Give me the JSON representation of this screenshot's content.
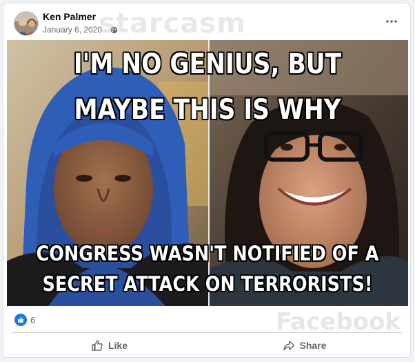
{
  "post": {
    "author": "Ken Palmer",
    "date": "January 6, 2020",
    "separator": "·",
    "privacy_icon": "globe-icon",
    "more_icon": "more-horizontal-icon"
  },
  "watermarks": {
    "top": "starcasm",
    "bottom": "Facebook"
  },
  "meme": {
    "top_line_1": "I'M NO GENIUS, BUT",
    "top_line_2": "MAYBE THIS IS WHY",
    "bottom_line_1": "CONGRESS WASN'T NOTIFIED OF A",
    "bottom_line_2": "SECRET ATTACK ON TERRORISTS!"
  },
  "reactions": {
    "icon": "like-reaction-icon",
    "count": "6"
  },
  "actions": {
    "like_label": "Like",
    "share_label": "Share"
  },
  "colors": {
    "accent": "#1877f2",
    "secondary_text": "#65676b",
    "primary_text": "#050505"
  }
}
